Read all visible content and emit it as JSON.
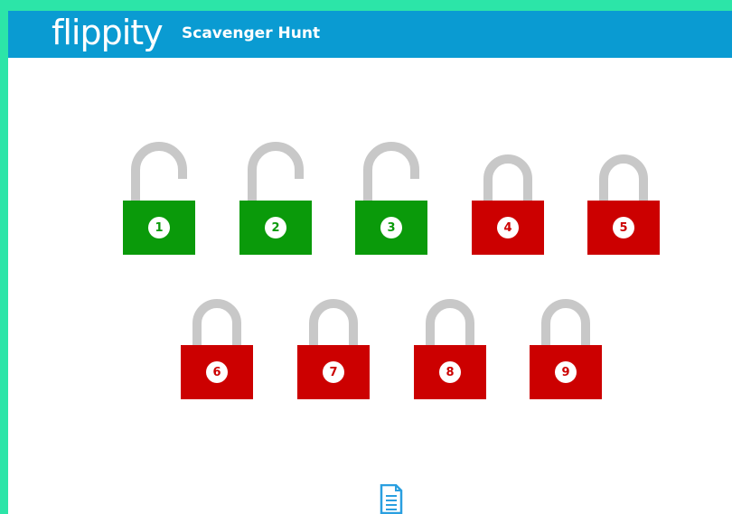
{
  "colors": {
    "frame": "#2ce5a8",
    "header": "#0a9bd2",
    "unlocked": "#0a9a0a",
    "locked": "#cc0000",
    "shackle": "#c8c8c8",
    "doc_icon": "#2a9fe0"
  },
  "header": {
    "logo_text": "flippity",
    "title": "Scavenger Hunt"
  },
  "locks": [
    {
      "label": "1",
      "state": "unlocked"
    },
    {
      "label": "2",
      "state": "unlocked"
    },
    {
      "label": "3",
      "state": "unlocked"
    },
    {
      "label": "4",
      "state": "locked"
    },
    {
      "label": "5",
      "state": "locked"
    },
    {
      "label": "6",
      "state": "locked"
    },
    {
      "label": "7",
      "state": "locked"
    },
    {
      "label": "8",
      "state": "locked"
    },
    {
      "label": "9",
      "state": "locked"
    }
  ],
  "footer": {
    "icon": "document-icon"
  }
}
